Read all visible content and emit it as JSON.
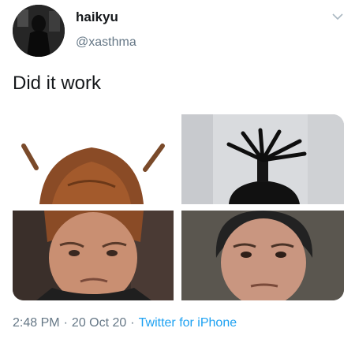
{
  "author": {
    "display_name": "haikyu",
    "handle": "@xasthma",
    "avatar_icon": "profile-avatar"
  },
  "tweet": {
    "text": "Did it work"
  },
  "media": {
    "images": [
      "hair-with-pigtails-image",
      "hair-with-top-tuft-image",
      "man-portrait-left-image",
      "man-portrait-right-image"
    ]
  },
  "footer": {
    "time": "2:48 PM",
    "date": "20 Oct 20",
    "source": "Twitter for iPhone",
    "separator": "·"
  },
  "colors": {
    "text": "#14171a",
    "secondary": "#657786",
    "link": "#1da1f2"
  }
}
